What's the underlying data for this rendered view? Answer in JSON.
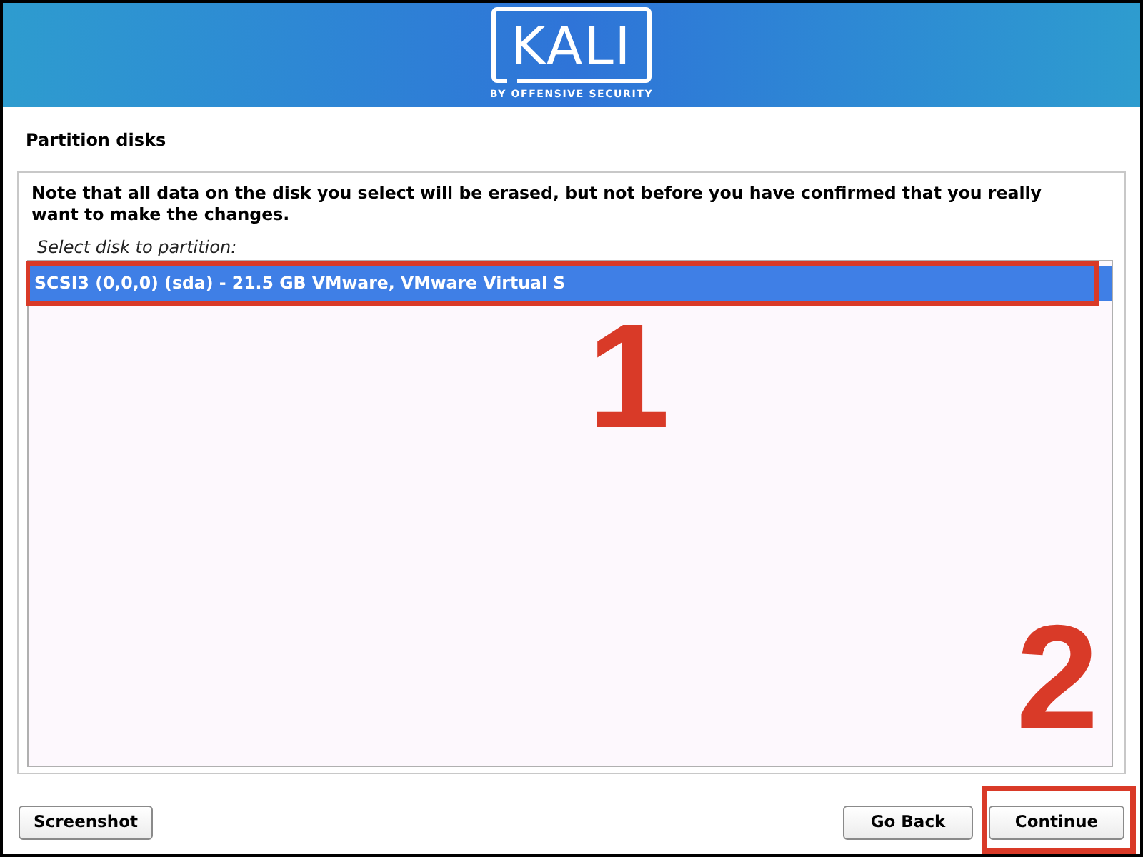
{
  "header": {
    "logo_text": "KALI",
    "tagline": "BY OFFENSIVE SECURITY"
  },
  "page_title": "Partition disks",
  "note": "Note that all data on the disk you select will be erased, but not before you have confirmed that you really want to make the changes.",
  "list_label": "Select disk to partition:",
  "disks": [
    {
      "label": "SCSI3 (0,0,0) (sda) - 21.5 GB VMware, VMware Virtual S",
      "selected": true,
      "highlighted": true
    }
  ],
  "step_markers": [
    "1",
    "2"
  ],
  "footer": {
    "left_buttons": [
      {
        "label": "Screenshot",
        "highlighted": false
      }
    ],
    "right_buttons": [
      {
        "label": "Go Back",
        "highlighted": false
      },
      {
        "label": "Continue",
        "highlighted": true
      }
    ]
  }
}
